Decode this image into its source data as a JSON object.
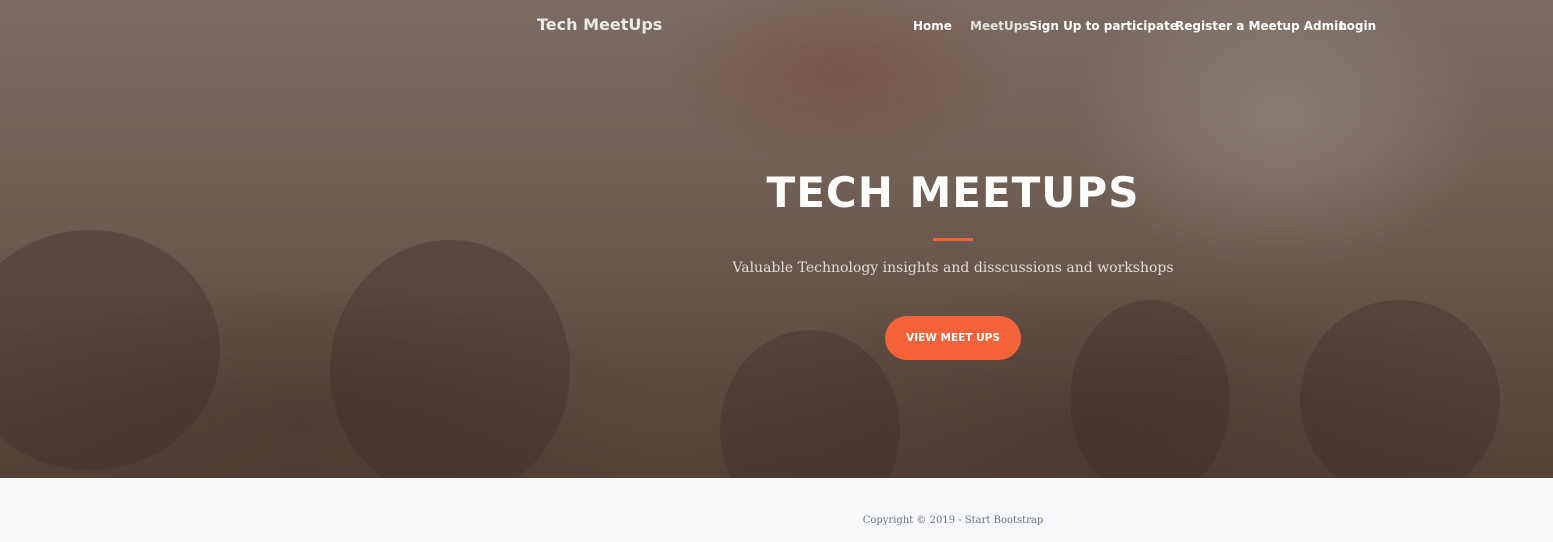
{
  "navbar": {
    "brand": "Tech MeetUps",
    "items": [
      {
        "label": "Home"
      },
      {
        "label": "MeetUps"
      },
      {
        "label": "Sign Up to participate"
      },
      {
        "label": "Register a Meetup Admin"
      },
      {
        "label": "Login"
      }
    ]
  },
  "hero": {
    "title": "TECH MEETUPS",
    "subtitle": "Valuable Technology insights and disscussions and workshops",
    "cta_label": "VIEW MEET UPS"
  },
  "footer": {
    "copyright": "Copyright © 2019 - Start Bootstrap"
  },
  "colors": {
    "accent": "#f4623a",
    "footer_bg": "#f8f9fa",
    "footer_text": "#6c757d"
  }
}
